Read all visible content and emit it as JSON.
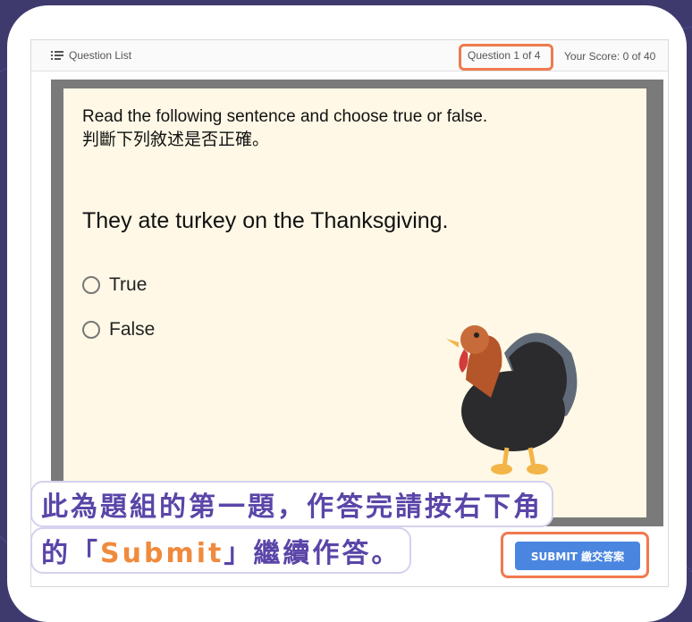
{
  "header": {
    "question_list": "Question List",
    "question_counter": "Question 1 of 4",
    "score": "Your Score: 0 of 40"
  },
  "question": {
    "instruction_en": "Read the following sentence and choose true or false.",
    "instruction_zh": "判斷下列敘述是否正確。",
    "sentence": "They ate turkey on the Thanksgiving.",
    "options": [
      "True",
      "False"
    ]
  },
  "banner": {
    "line1": "此為題組的第一題，作答完請按右下角",
    "line2_prefix": "的「",
    "line2_accent": "Submit",
    "line2_suffix": "」繼續作答。"
  },
  "submit_label": "SUBMIT 繳交答案",
  "colors": {
    "background": "#3f3a6e",
    "highlight": "#f07a4d",
    "banner_text": "#5a45a8",
    "accent": "#f08a3c",
    "submit": "#4a86e0"
  },
  "icons": {
    "question_list": "list-icon",
    "illustration": "turkey-icon"
  }
}
